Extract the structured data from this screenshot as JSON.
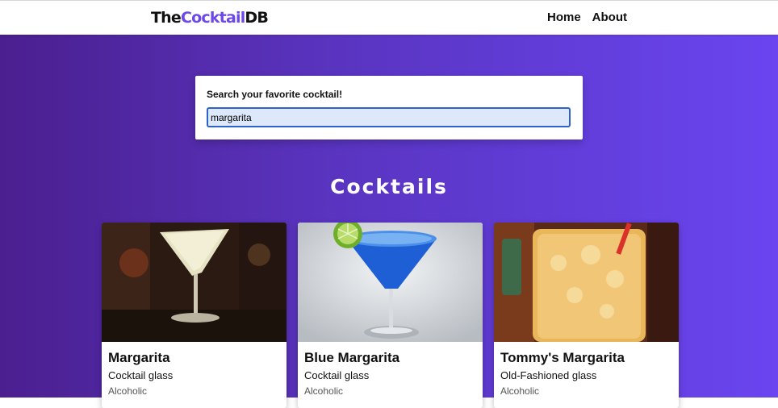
{
  "nav": {
    "logo_prefix": "The",
    "logo_accent": "Cocktail",
    "logo_suffix": "DB",
    "links": [
      "Home",
      "About"
    ]
  },
  "search": {
    "label": "Search your favorite cocktail!",
    "value": "margarita"
  },
  "main": {
    "title": "Cocktails",
    "cocktails": [
      {
        "name": "Margarita",
        "glass": "Cocktail glass",
        "type": "Alcoholic",
        "icon": "margarita-photo"
      },
      {
        "name": "Blue Margarita",
        "glass": "Cocktail glass",
        "type": "Alcoholic",
        "icon": "blue-margarita-photo"
      },
      {
        "name": "Tommy's Margarita",
        "glass": "Old-Fashioned glass",
        "type": "Alcoholic",
        "icon": "tommys-margarita-photo"
      }
    ]
  },
  "colors": {
    "accent": "#6d47e8",
    "gradient_start": "#4b1f8f",
    "gradient_end": "#6a45f0"
  }
}
